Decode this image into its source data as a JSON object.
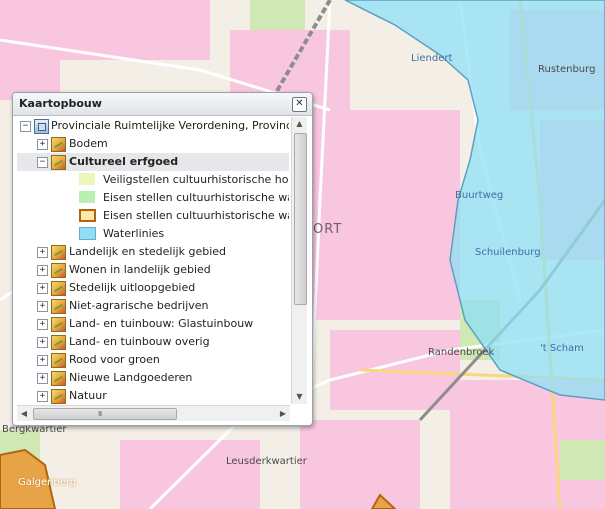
{
  "panel": {
    "title": "Kaartopbouw",
    "close_glyph": "✕"
  },
  "tree": {
    "root_label": "Provinciale Ruimtelijke Verordening, Provincie Utr",
    "items": [
      {
        "label": "Bodem",
        "expander": "+"
      },
      {
        "label": "Cultureel erfgoed",
        "expander": "−",
        "selected": true
      },
      {
        "label": "Landelijk en stedelijk gebied",
        "expander": "+"
      },
      {
        "label": "Wonen in landelijk gebied",
        "expander": "+"
      },
      {
        "label": "Stedelijk uitloopgebied",
        "expander": "+"
      },
      {
        "label": "Niet-agrarische bedrijven",
        "expander": "+"
      },
      {
        "label": "Land- en tuinbouw: Glastuinbouw",
        "expander": "+"
      },
      {
        "label": "Land- en tuinbouw overig",
        "expander": "+"
      },
      {
        "label": "Rood voor groen",
        "expander": "+"
      },
      {
        "label": "Nieuwe Landgoederen",
        "expander": "+"
      },
      {
        "label": "Natuur",
        "expander": "+"
      }
    ],
    "legend": [
      {
        "label": "Veiligstellen cultuurhistorische hoofdstru",
        "fill": "#eaf7b8",
        "stroke": "#eaf7b8"
      },
      {
        "label": "Eisen stellen cultuurhistorische waarden",
        "fill": "#b9f0b2",
        "stroke": "#b9f0b2"
      },
      {
        "label": "Eisen stellen cultuurhistorische waarden",
        "fill": "#ffe9a8",
        "stroke": "#b2650e"
      },
      {
        "label": "Waterlinies",
        "fill": "#8fe0f5",
        "stroke": "#6aa9c9"
      }
    ],
    "scroll": {
      "up": "▲",
      "down": "▼",
      "left": "◀",
      "right": "▶",
      "grip": "III"
    }
  },
  "map_labels": {
    "liendert": "Liendert",
    "rustenburg": "Rustenburg",
    "buurtweg": "Buurtweg",
    "schuilenburg": "Schuilenburg",
    "randenbroek": "Randenbroek",
    "t_scham": "'t Scham",
    "leusderkwartier": "Leusderkwartier",
    "bergkwartier": "Bergkwartier",
    "galgenberg": "Galgenberg",
    "city_fragment": "ORT"
  },
  "colors": {
    "waterlinie": "#8fe0f5",
    "residential": "#f9c6df",
    "background": "#f4efe6"
  }
}
